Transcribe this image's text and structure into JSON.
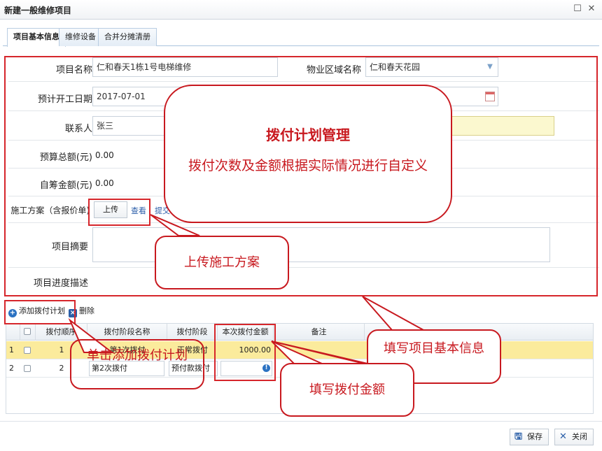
{
  "window": {
    "title": "新建一般维修项目",
    "maximize_icon": "maximize-icon",
    "close_icon": "close-icon"
  },
  "tabs": [
    {
      "label": "项目基本信息",
      "active": true
    },
    {
      "label": "维修设备",
      "active": false
    },
    {
      "label": "合并分摊清册",
      "active": false
    }
  ],
  "form": {
    "project_name": {
      "label": "项目名称",
      "value": "仁和春天1栋1号电梯维修"
    },
    "property_area": {
      "label": "物业区域名称",
      "value": "仁和春天花园"
    },
    "start_date": {
      "label": "预计开工日期",
      "value": "2017-07-01"
    },
    "contact": {
      "label": "联系人",
      "value": "张三"
    },
    "budget_total": {
      "label": "预算总额(元)",
      "value": "0.00"
    },
    "self_funded": {
      "label": "自筹金额(元)",
      "value": "0.00"
    },
    "construction_plan": {
      "label": "施工方案（含报价单)",
      "upload_label": "上传",
      "view_label": "查看",
      "extra_label": "提交"
    },
    "summary": {
      "label": "项目摘要",
      "value": ""
    },
    "progress": {
      "label": "项目进度描述",
      "value": ""
    }
  },
  "toolbar": {
    "add_label": "添加拨付计划",
    "delete_label": "删除"
  },
  "grid": {
    "headers": [
      "拨付顺序",
      "拨付阶段名称",
      "拨付阶段",
      "本次拨付金额(元)",
      "备注"
    ],
    "rows": [
      {
        "num": "1",
        "order": "1",
        "stage_name": "第1次拨付",
        "stage": "正常拨付",
        "amount": "1000.00",
        "remark": ""
      },
      {
        "num": "2",
        "order": "2",
        "stage_name": "第2次拨付",
        "stage": "预付款拨付",
        "amount": "",
        "remark": ""
      }
    ]
  },
  "footer": {
    "save_label": "保存",
    "close_label": "关闭"
  },
  "annotations": {
    "main_title": "拨付计划管理",
    "main_body": "拨付次数及金额根据实际情况进行自定义",
    "upload_plan": "上传施工方案",
    "basic_info": "填写项目基本信息",
    "add_plan": "单击添加拨付计划",
    "fill_amount": "填写拨付金额"
  },
  "colors": {
    "annotation_red": "#d6262b",
    "selected_row": "#fbeb9c",
    "yellow_field": "#fbf8cf"
  }
}
